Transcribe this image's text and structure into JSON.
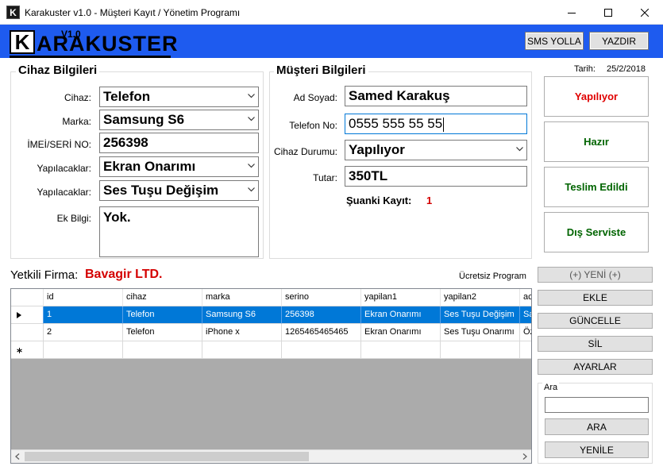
{
  "window": {
    "title": "Karakuster v1.0  -  Müşteri Kayıt / Yönetim Programı",
    "app_icon_letter": "K"
  },
  "header": {
    "logo_letter": "K",
    "logo_version": "V1.0",
    "logo_name": "ARAKUSTER",
    "sms_button": "SMS YOLLA",
    "print_button": "YAZDIR",
    "brand_color": "#1e5bef"
  },
  "date": {
    "label": "Tarih:",
    "value": "25/2/2018"
  },
  "device": {
    "title": "Cihaz Bilgileri",
    "cihaz_label": "Cihaz:",
    "cihaz_value": "Telefon",
    "marka_label": "Marka:",
    "marka_value": "Samsung S6",
    "imei_label": "İMEİ/SERİ NO:",
    "imei_value": "256398",
    "yapilacak1_label": "Yapılacaklar:",
    "yapilacak1_value": "Ekran Onarımı",
    "yapilacak2_label": "Yapılacaklar:",
    "yapilacak2_value": "Ses Tuşu Değişim",
    "ekbilgi_label": "Ek Bilgi:",
    "ekbilgi_value": "Yok."
  },
  "customer": {
    "title": "Müşteri Bilgileri",
    "adsoyad_label": "Ad Soyad:",
    "adsoyad_value": "Samed Karakuş",
    "telefon_label": "Telefon No:",
    "telefon_value": "0555 555 55 55",
    "durum_label": "Cihaz Durumu:",
    "durum_value": "Yapılıyor",
    "tutar_label": "Tutar:",
    "tutar_value": "350TL",
    "kayit_label": "Şuanki Kayıt:",
    "kayit_value": "1"
  },
  "status_buttons": [
    {
      "label": "Yapılıyor",
      "color": "#e00000"
    },
    {
      "label": "Hazır",
      "color": "#006400"
    },
    {
      "label": "Teslim Edildi",
      "color": "#006400"
    },
    {
      "label": "Dış Serviste",
      "color": "#006400"
    }
  ],
  "firma": {
    "label": "Yetkili Firma:",
    "value": "Bavagir LTD.",
    "value_color": "#d40000"
  },
  "free_label": "Ücretsiz Program",
  "actions": {
    "new": "(+) YENİ (+)",
    "add": "EKLE",
    "update": "GÜNCELLE",
    "delete": "SİL",
    "settings": "AYARLAR"
  },
  "grid": {
    "columns": [
      "id",
      "cihaz",
      "marka",
      "serino",
      "yapilan1",
      "yapilan2",
      "ac"
    ],
    "rows": [
      [
        "1",
        "Telefon",
        "Samsung S6",
        "256398",
        "Ekran Onarımı",
        "Ses Tuşu Değişim",
        "Sa"
      ],
      [
        "2",
        "Telefon",
        "iPhone x",
        "1265465465465",
        "Ekran Onarımı",
        "Ses Tuşu Onarımı",
        "Öz"
      ]
    ],
    "selected_row": 0
  },
  "search": {
    "title": "Ara",
    "value": "",
    "search_button": "ARA",
    "refresh_button": "YENİLE"
  }
}
